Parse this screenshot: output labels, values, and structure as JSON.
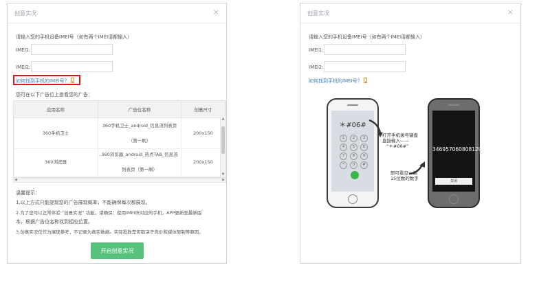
{
  "dialog_title": "创意实况",
  "instruction": "请输入您的手机设备IMEI号（如有两个IMEI请都输入）",
  "imei1_label": "IMEI1:",
  "imei2_label": "IMEI2:",
  "imei1_value": "",
  "imei2_value": "",
  "find_imei_link": "如何找到手机的IMEI号？",
  "view_text": "您可在以下广告位上查看您的广告：",
  "table": {
    "headers": [
      "应用名称",
      "广告位名称",
      "创意尺寸"
    ],
    "rows": [
      {
        "app": "360手机卫士",
        "slot_line1": "360手机卫士_android_信息流列表页",
        "slot_line2": "（第一刷）",
        "size": "200x150"
      },
      {
        "app": "360浏览器",
        "slot_line1": "360浏览器_android_热点TAB_信息流",
        "slot_line2": "列表页（第一刷）",
        "size": "200x150"
      }
    ]
  },
  "tips": {
    "title": "温馨提示：",
    "line1": "1.以上方式只能提现您的广告展现概率，不能确保每次都展现。",
    "line2a": "2.为了您可以正常体验 “创意实况” 功能，请确保：使用IMEI所对应的手机，APP更新至最新版",
    "line2b": "本，根据广告位名称找到相应位置。",
    "line3": "3.创意实况仅作为展现参考，不记录为真实数据。实际投放是否取决于竞价和媒体限制等原因。"
  },
  "start_button": "开启创意实况",
  "phone_left": {
    "dial": "＊#06#",
    "keys": [
      "1",
      "2",
      "3",
      "4",
      "5",
      "6",
      "7",
      "8",
      "9",
      "*",
      "0",
      "#"
    ]
  },
  "phone_right": {
    "imei_value": "346957060808129",
    "ok_label": "关闭"
  },
  "annotation1_line1": "打开手机拨号键盘",
  "annotation1_line2": "直接输入——",
  "annotation1_line3": "“＊#06#”",
  "annotation2_line1": "即可看见一串",
  "annotation2_line2": "15位数的数字"
}
